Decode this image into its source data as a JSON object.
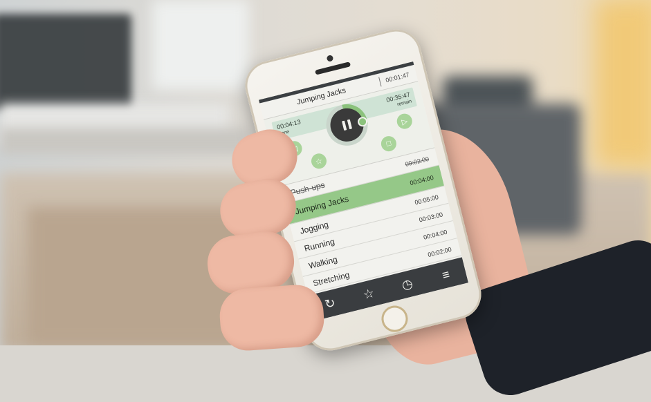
{
  "app": {
    "title": "Jumping Jacks",
    "elapsed": "00:01:47"
  },
  "timer": {
    "done_time": "00:04:13",
    "done_label": "done",
    "remain_time": "00:35:47",
    "remain_label": "remain"
  },
  "exercises": [
    {
      "name": "Push-ups",
      "time": "00:02:00",
      "state": "done"
    },
    {
      "name": "Jumping Jacks",
      "time": "00:04:00",
      "state": "active"
    },
    {
      "name": "Jogging",
      "time": "00:05:00",
      "state": "upcoming"
    },
    {
      "name": "Running",
      "time": "00:03:00",
      "state": "upcoming"
    },
    {
      "name": "Walking",
      "time": "00:04:00",
      "state": "upcoming"
    },
    {
      "name": "Stretching",
      "time": "00:02:00",
      "state": "upcoming"
    }
  ],
  "icons": {
    "prev": "rewind-icon",
    "next": "fast-forward-icon",
    "favorite": "star-icon",
    "stop": "stop-icon",
    "pause": "pause-icon",
    "tab_repeat": "repeat-icon",
    "tab_favorites": "star-icon",
    "tab_clock": "clock-icon",
    "tab_menu": "menu-icon"
  },
  "colors": {
    "accent": "#95c888",
    "dark": "#3a3d40"
  }
}
